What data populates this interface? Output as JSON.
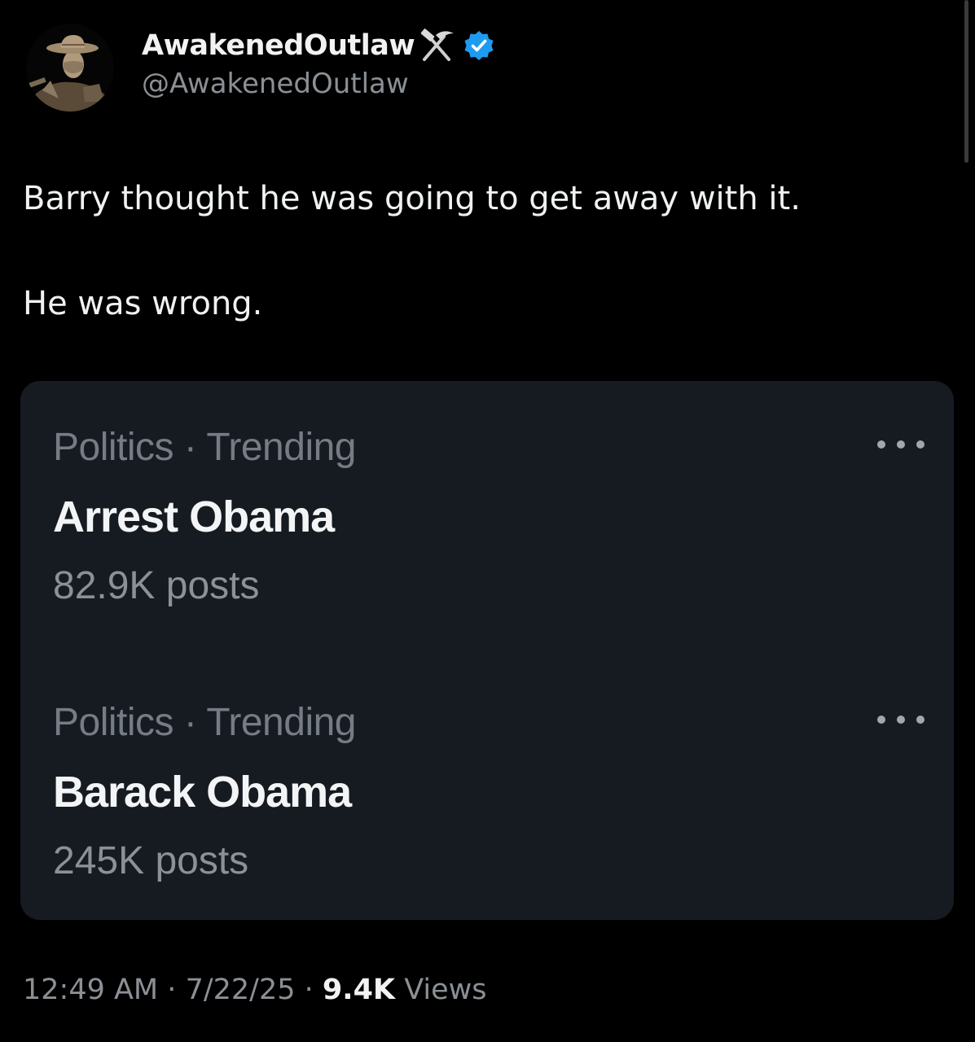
{
  "author": {
    "display_name": "AwakenedOutlaw",
    "handle": "@AwakenedOutlaw",
    "name_icon": "hammer-and-pick-icon",
    "verified_icon": "verified-badge-icon",
    "verified_color": "#1d9bf0"
  },
  "tweet": {
    "paragraphs": [
      "Barry thought he was going to get away with it.",
      "He was wrong."
    ]
  },
  "trends": [
    {
      "category": "Politics · Trending",
      "title": "Arrest Obama",
      "posts": "82.9K posts"
    },
    {
      "category": "Politics · Trending",
      "title": "Barack Obama",
      "posts": "245K posts"
    }
  ],
  "footer": {
    "time": "12:49 AM",
    "separator": "·",
    "date": "7/22/25",
    "views_count": "9.4K",
    "views_label": "Views"
  },
  "colors": {
    "background": "#000000",
    "card": "#161b22",
    "muted_text": "#8b9095"
  }
}
